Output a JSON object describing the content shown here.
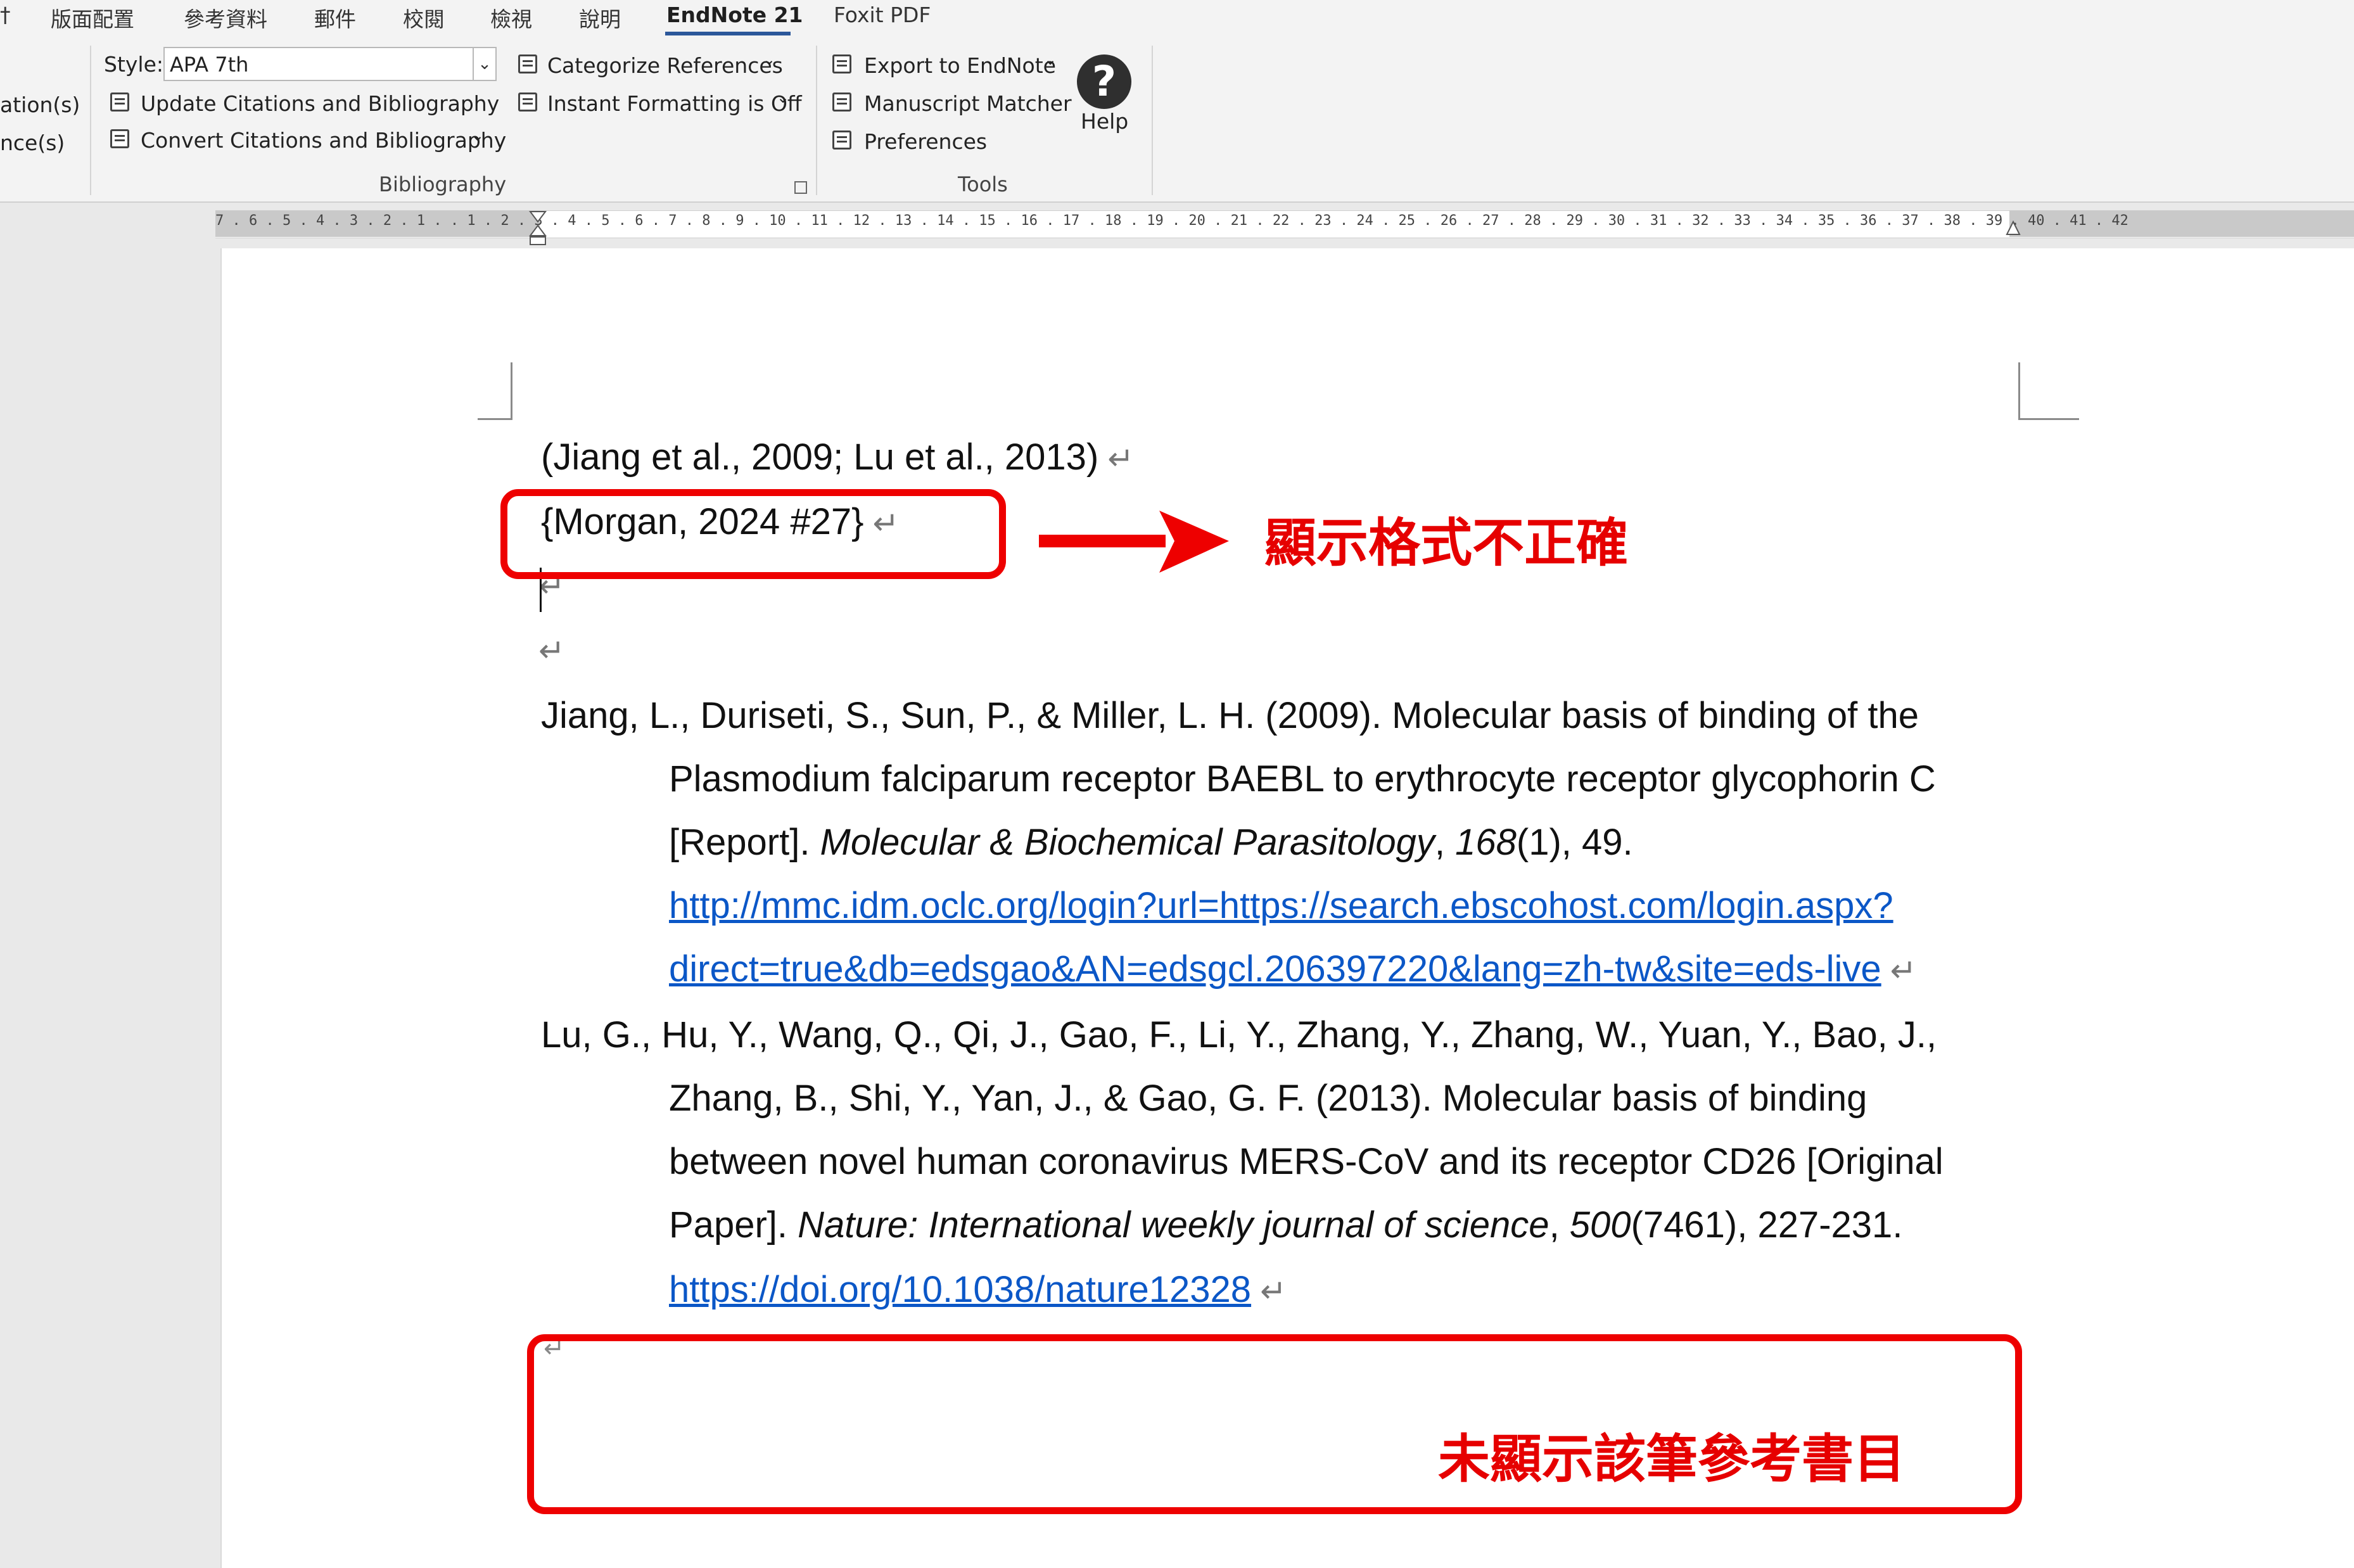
{
  "ribbon": {
    "tabs": [
      "版面配置",
      "參考資料",
      "郵件",
      "校閱",
      "檢視",
      "說明",
      "EndNote 21",
      "Foxit PDF"
    ],
    "left_truncated": [
      "ation(s)",
      "nce(s)"
    ],
    "style_label": "Style:",
    "style_value": "APA 7th",
    "update_label": "Update Citations and Bibliography",
    "convert_label": "Convert Citations and Bibliography",
    "categorize_label": "Categorize References",
    "instant_label": "Instant Formatting is Off",
    "bibliography_group": "Bibliography",
    "export_label": "Export to EndNote",
    "manuscript_label": "Manuscript Matcher",
    "preferences_label": "Preferences",
    "help_label": "Help",
    "tools_group": "Tools"
  },
  "ruler": {
    "numbers": "7 . 6 . 5 . 4 . 3 . 2 . 1 .   . 1 . 2 . 3 . 4 . 5 . 6 . 7 . 8 . 9 . 10 . 11 . 12 . 13 . 14 . 15 . 16 . 17 . 18 . 19 . 20 . 21 . 22 . 23 . 24 . 25 . 26 . 27 . 28 . 29 . 30 . 31 . 32 . 33 . 34 . 35 . 36 . 37 . 38 . 39 . 40 . 41 . 42"
  },
  "document": {
    "citation1": "(Jiang et al., 2009; Lu et al., 2013)",
    "citation2": "{Morgan, 2024 #27}",
    "pilcrow": "↵",
    "ref1": {
      "l1": "Jiang, L., Duriseti, S., Sun, P., & Miller, L. H. (2009). Molecular basis of binding of the",
      "l2": "Plasmodium falciparum receptor BAEBL to erythrocyte receptor glycophorin C",
      "l3a": "[Report]. ",
      "l3b": "Molecular & Biochemical Parasitology",
      "l3c": ", ",
      "l3d": "168",
      "l3e": "(1), 49.",
      "url1": "http://mmc.idm.oclc.org/login?url=https://search.ebscohost.com/login.aspx?",
      "url2": "direct=true&db=edsgao&AN=edsgcl.206397220&lang=zh-tw&site=eds-live"
    },
    "ref2": {
      "l1": "Lu, G., Hu, Y., Wang, Q., Qi, J., Gao, F., Li, Y., Zhang, Y., Zhang, W., Yuan, Y., Bao, J.,",
      "l2": "Zhang, B., Shi, Y., Yan, J., & Gao, G. F. (2013). Molecular basis of binding",
      "l3": "between novel human coronavirus MERS-CoV and its receptor CD26 [Original",
      "l4a": "Paper]. ",
      "l4b": "Nature: International weekly journal of science",
      "l4c": ", ",
      "l4d": "500",
      "l4e": "(7461), 227-231.",
      "doi": "https://doi.org/10.1038/nature12328"
    }
  },
  "annotations": {
    "incorrect_format": "顯示格式不正確",
    "missing_reference": "未顯示該筆參考書目",
    "color": "#e60000"
  }
}
